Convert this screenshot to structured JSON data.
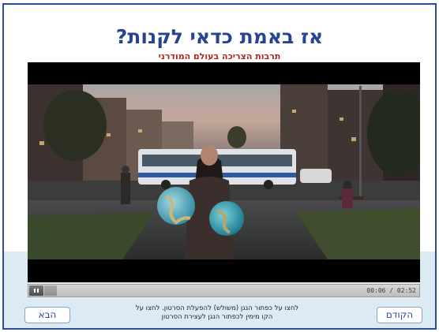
{
  "header": {
    "title": "אז באמת כדאי לקנות?",
    "subtitle": "תרבות הצריכה בעולם המודרני"
  },
  "player": {
    "current_time": "00:06",
    "duration": "02:52",
    "time_display": "00:06 / 02:52",
    "progress": 0.035,
    "state": "playing",
    "pause_icon": "pause-icon"
  },
  "instructions": {
    "line1": "לחצו על כפתור הנגן (משולש) להפעלת הסרטון. לחצו על",
    "line2": "הקו מימין לכפתור הנגן לעצירת הסרטון"
  },
  "navigation": {
    "prev_label": "הקודם",
    "next_label": "הבא"
  },
  "colors": {
    "frame_border": "#2a4d9b",
    "title": "#27458f",
    "subtitle": "#b0271e",
    "lower_band": "#dbeaf3"
  }
}
